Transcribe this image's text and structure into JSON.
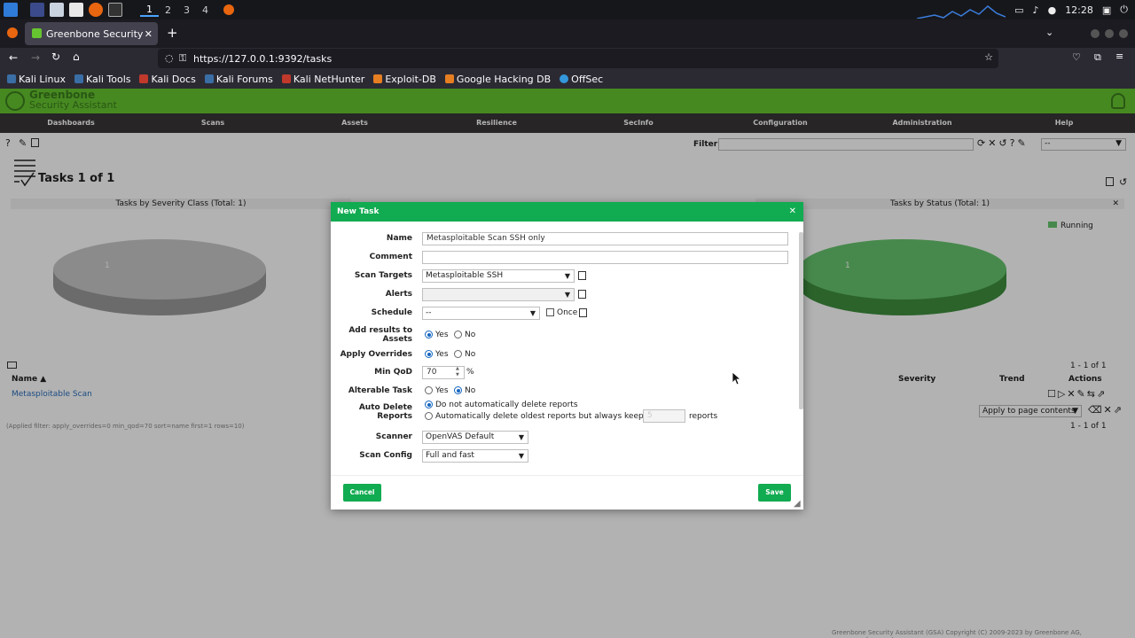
{
  "desktop": {
    "workspaces": [
      "1",
      "2",
      "3",
      "4"
    ],
    "clock": "12:28"
  },
  "browser": {
    "tab_title": "Greenbone Security Assis",
    "url": "https://127.0.0.1:9392/tasks",
    "bookmarks": [
      "Kali Linux",
      "Kali Tools",
      "Kali Docs",
      "Kali Forums",
      "Kali NetHunter",
      "Exploit-DB",
      "Google Hacking DB",
      "OffSec"
    ]
  },
  "gsa": {
    "brand_line1": "Greenbone",
    "brand_line2": "Security Assistant",
    "menu": [
      "Dashboards",
      "Scans",
      "Assets",
      "Resilience",
      "SecInfo",
      "Configuration",
      "Administration",
      "Help"
    ],
    "filter_label": "Filter",
    "filter_select": "--",
    "page_title": "Tasks 1 of 1",
    "chart_severity_title": "Tasks by Severity Class (Total: 1)",
    "chart_status_title": "Tasks by Status (Total: 1)",
    "pie_left_label": "1",
    "pie_right_label": "1",
    "legend_running": "Running",
    "table": {
      "col_name": "Name ▲",
      "col_severity": "Severity",
      "col_trend": "Trend",
      "col_actions": "Actions",
      "row_name": "Metasploitable Scan",
      "pagination": "1 - 1 of 1",
      "bulk_select": "Apply to page contents",
      "applied_filter": "(Applied filter: apply_overrides=0 min_qod=70 sort=name first=1 rows=10)"
    },
    "copyright": "Greenbone Security Assistant (GSA) Copyright (C) 2009-2023 by Greenbone AG, www.greenbone.net"
  },
  "dialog": {
    "title": "New Task",
    "name_label": "Name",
    "name_value": "Metasploitable Scan SSH only",
    "comment_label": "Comment",
    "comment_value": "",
    "targets_label": "Scan Targets",
    "targets_value": "Metasploitable SSH",
    "alerts_label": "Alerts",
    "alerts_value": "",
    "schedule_label": "Schedule",
    "schedule_value": "--",
    "once_label": "Once",
    "add_results_label_1": "Add results to",
    "add_results_label_2": "Assets",
    "yes": "Yes",
    "no": "No",
    "apply_overrides_label": "Apply Overrides",
    "min_qod_label": "Min QoD",
    "min_qod_value": "70",
    "percent": "%",
    "alterable_label": "Alterable Task",
    "auto_delete_label_1": "Auto Delete",
    "auto_delete_label_2": "Reports",
    "auto_delete_opt1": "Do not automatically delete reports",
    "auto_delete_opt2": "Automatically delete oldest reports but always keep newest",
    "keep_value": "5",
    "reports_suffix": "reports",
    "scanner_label": "Scanner",
    "scanner_value": "OpenVAS Default",
    "config_label": "Scan Config",
    "config_value": "Full and fast",
    "cancel": "Cancel",
    "save": "Save"
  },
  "colors": {
    "gsa_green": "#66c430",
    "dialog_green": "#11ab51",
    "menu_dark": "#393637"
  }
}
